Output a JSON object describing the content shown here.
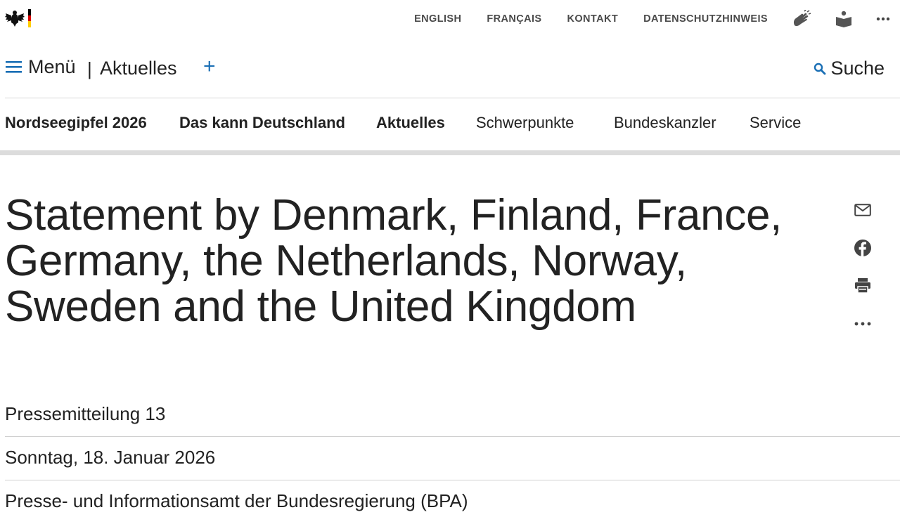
{
  "colors": {
    "accent": "#1a6fb5",
    "text": "#222222",
    "flag_black": "#000000",
    "flag_red": "#dd0000",
    "flag_gold": "#ffce00"
  },
  "top_links": [
    "ENGLISH",
    "FRANÇAIS",
    "KONTAKT",
    "DATENSCHUTZHINWEIS"
  ],
  "top_icons": [
    "sign-language-icon",
    "easy-language-icon",
    "more-icon"
  ],
  "header": {
    "menu_label": "Menü",
    "separator": "|",
    "breadcrumb": "Aktuelles",
    "plus": "+",
    "search_label": "Suche"
  },
  "main_nav": [
    {
      "label": "Nordseegipfel 2026",
      "bold": true
    },
    {
      "label": "Das kann Deutschland",
      "bold": true
    },
    {
      "label": "Aktuelles",
      "bold": true
    },
    {
      "label": "Schwerpunkte",
      "bold": false
    },
    {
      "label": "Bundeskanzler",
      "bold": false
    },
    {
      "label": "Service",
      "bold": false
    }
  ],
  "article": {
    "title": "Statement by Denmark, Finland, France, Germany, the Netherlands, Norway, Sweden and the United Kingdom",
    "meta": {
      "type": "Pressemitteilung 13",
      "date": "Sonntag, 18. Januar 2026",
      "publisher": "Presse- und Informationsamt der Bundesregierung (BPA)"
    }
  },
  "share_icons": [
    "mail-icon",
    "facebook-icon",
    "print-icon",
    "more-icon"
  ]
}
